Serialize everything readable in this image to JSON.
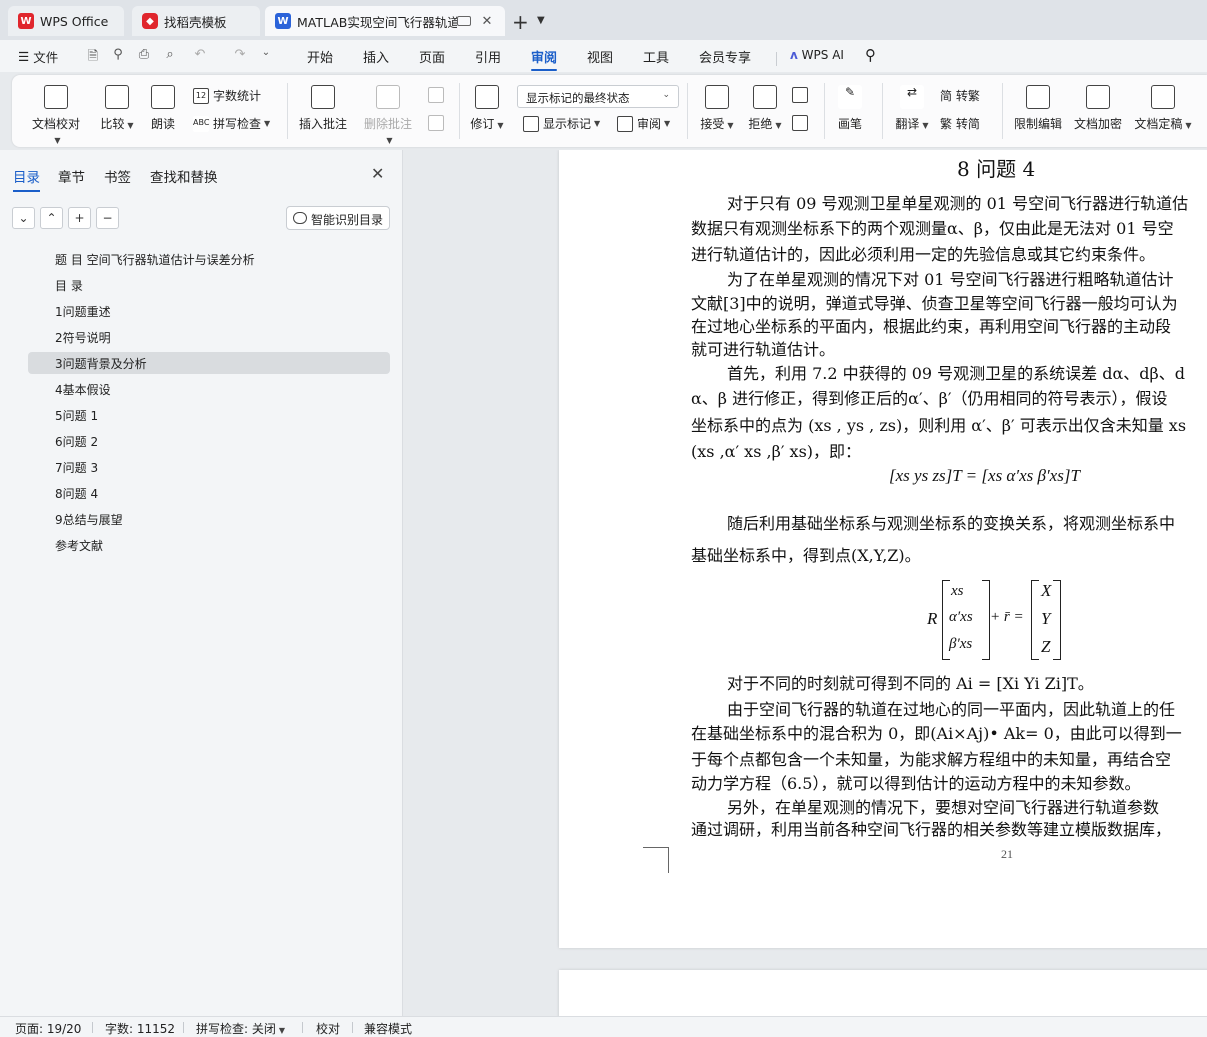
{
  "tabs": [
    {
      "label": "WPS Office",
      "icon": "wps-logo-icon"
    },
    {
      "label": "找稻壳模板",
      "icon": "docer-icon"
    },
    {
      "label": "MATLAB实现空间飞行器轨道估",
      "icon": "writer-icon"
    }
  ],
  "menu": {
    "file": "文件",
    "items": [
      "开始",
      "插入",
      "页面",
      "引用",
      "审阅",
      "视图",
      "工具",
      "会员专享"
    ],
    "active": "审阅",
    "wps_ai": "WPS AI"
  },
  "ribbon": {
    "proofread": "文档校对",
    "compare": "比较",
    "read_aloud": "朗读",
    "word_count": "字数统计",
    "spell_check": "拼写检查",
    "insert_comment": "插入批注",
    "delete_comment": "删除批注",
    "track_changes": "修订",
    "display_mode": "显示标记的最终状态",
    "show_markup": "显示标记",
    "review": "审阅",
    "accept": "接受",
    "reject": "拒绝",
    "pen": "画笔",
    "translate": "翻译",
    "to_traditional": "简 转繁",
    "to_simplified": "繁 转简",
    "restrict_edit": "限制编辑",
    "encrypt": "文档加密",
    "finalize": "文档定稿"
  },
  "sidebar": {
    "tabs": [
      "目录",
      "章节",
      "书签",
      "查找和替换"
    ],
    "smart_toc": "智能识别目录",
    "toc": [
      "题 目 空间飞行器轨道估计与误差分析",
      "目 录",
      "1问题重述",
      "2符号说明",
      "3问题背景及分析",
      "4基本假设",
      "5问题 1",
      "6问题 2",
      "7问题 3",
      "8问题 4",
      "9总结与展望",
      "参考文献"
    ],
    "selected_index": 4
  },
  "document": {
    "heading": "8  问题 4",
    "lines": [
      "对于只有 09 号观测卫星单星观测的 01 号空间飞行器进行轨道估",
      "数据只有观测坐标系下的两个观测量α、β，仅由此是无法对 01 号空",
      "进行轨道估计的，因此必须利用一定的先验信息或其它约束条件。",
      "为了在单星观测的情况下对 01 号空间飞行器进行粗略轨道估计",
      "文献[3]中的说明，弹道式导弹、侦查卫星等空间飞行器一般均可认为",
      "在过地心坐标系的平面内，根据此约束，再利用空间飞行器的主动段",
      "就可进行轨道估计。",
      "首先，利用 7.2 中获得的 09 号观测卫星的系统误差 dα、dβ、d",
      "α、β 进行修正，得到修正后的α′、β′（仍用相同的符号表示），假设",
      "坐标系中的点为 (xs , ys , zs)，则利用 α′、β′ 可表示出仅含未知量 xs",
      "(xs ,α′ xs ,β′ xs)，即：",
      "随后利用基础坐标系与观测坐标系的变换关系，将观测坐标系中",
      "基础坐标系中，得到点(X,Y,Z)。",
      "对于不同的时刻就可得到不同的 Ai = [Xi  Yi Zi]T。",
      "由于空间飞行器的轨道在过地心的同一平面内，因此轨道上的任",
      "在基础坐标系中的混合积为 0，即(Ai×Aj)• Ak= 0，由此可以得到一",
      "于每个点都包含一个未知量，为能求解方程组中的未知量，再结合空",
      "动力学方程（6.5），就可以得到估计的运动方程中的未知参数。",
      "另外，在单星观测的情况下，要想对空间飞行器进行轨道参数",
      "通过调研，利用当前各种空间飞行器的相关参数等建立模版数据库，"
    ],
    "eq1": "[xs  ys  zs]T = [xs  α′xs  β′xs]T",
    "eq2_left": "R",
    "eq2_vec": [
      "xs",
      "α′xs",
      "β′xs"
    ],
    "eq2_mid": "+ r̄ =",
    "eq2_rhs": [
      "X",
      "Y",
      "Z"
    ],
    "page_number": "21"
  },
  "status": {
    "page": "页面: 19/20",
    "words": "字数: 11152",
    "spell": "拼写检查: 关闭",
    "proof": "校对",
    "compat": "兼容模式"
  },
  "colors": {
    "accent": "#1a5ec9",
    "wps_red": "#e0262d",
    "writer_blue": "#2b63d9"
  }
}
